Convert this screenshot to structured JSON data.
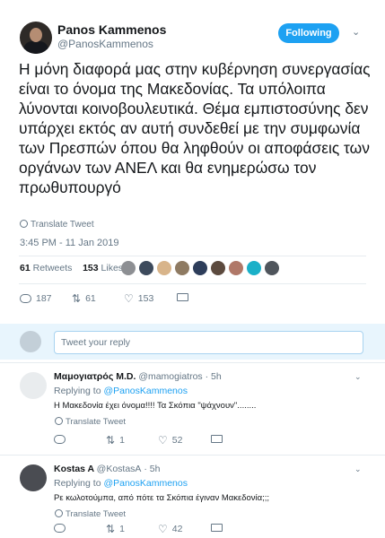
{
  "tweet": {
    "author_name": "Panos Kammenos",
    "author_handle": "@PanosKammenos",
    "follow_label": "Following",
    "text": "Η μόνη  διαφορά μας στην κυβέρνηση συνεργασίας είναι το όνομα της Μακεδονίας. Τα υπόλοιπα λύνονται κοινοβουλευτικά. Θέμα εμπιστοσύνης δεν υπάρχει εκτός αν αυτή συνδεθεί με την συμφωνία των Πρεσπών όπου θα ληφθούν οι αποφάσεις των οργάνων των ΑΝΕΛ και θα ενημερώσω τον πρωθυπουργό",
    "translate_label": "Translate Tweet",
    "timestamp": "3:45 PM - 11 Jan 2019",
    "retweets_count": "61",
    "retweets_label": "Retweets",
    "likes_count": "153",
    "likes_label": "Likes",
    "actions": {
      "replies": "187",
      "retweets": "61",
      "likes": "153"
    },
    "liker_colors": [
      "#8d8f93",
      "#3d4a5c",
      "#d8b48a",
      "#8e7a62",
      "#2d3d5a",
      "#5c4a3e",
      "#b07868",
      "#1ab0c8",
      "#4f555c"
    ]
  },
  "reply_box": {
    "placeholder": "Tweet your reply"
  },
  "replies": [
    {
      "name": "Μαμογιατρός M.D.",
      "handle": "@mamogiatros",
      "age": "· 5h",
      "replying_prefix": "Replying to",
      "replying_to": "@PanosKammenos",
      "text": "Η Μακεδονία έχει όνομα!!!!  Τα Σκόπια \"ψάχνουν\"........",
      "translate_label": "Translate Tweet",
      "retweets": "1",
      "likes": "52"
    },
    {
      "name": "Kostas A",
      "handle": "@KostasA",
      "age": "· 5h",
      "replying_prefix": "Replying to",
      "replying_to": "@PanosKammenos",
      "text": "Ρε κωλοτούμπα, από πότε τα Σκόπια έγιναν Μακεδονία;;;",
      "translate_label": "Translate Tweet",
      "retweets": "1",
      "likes": "42"
    }
  ]
}
